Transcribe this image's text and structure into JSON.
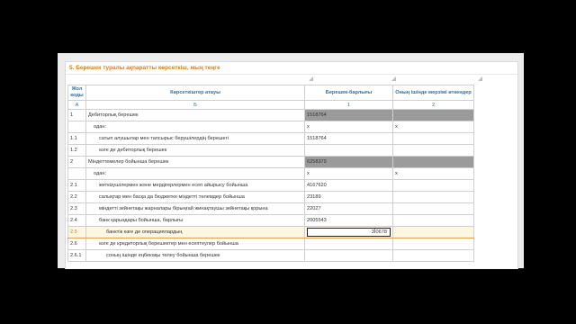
{
  "section_title": "5. Берешек туралы ақпаратты көрсеткіш, мың теңге",
  "headers": {
    "code": "Жол коды",
    "name": "Көрсеткіштер атауы",
    "debt": "Берешек-барлығы",
    "overdue": "Оның ішінде мерзімі өткендер"
  },
  "letters": {
    "code": "А",
    "name": "Б",
    "debt": "1",
    "overdue": "2"
  },
  "rows": [
    {
      "code": "1",
      "name": "Дебиторлық берешек",
      "debt": "1518764",
      "overdue": ""
    },
    {
      "code": "",
      "name": "одан:",
      "debt": "x",
      "overdue": "x"
    },
    {
      "code": "1.1",
      "name": "сатып алушылар мен тапсырыс берушілердің берешегі",
      "debt": "1518764",
      "overdue": ""
    },
    {
      "code": "1.2",
      "name": "өзге де дебиторлық берешек",
      "debt": "",
      "overdue": ""
    },
    {
      "code": "2",
      "name": "Міндеттемелер бойынша берешек",
      "debt": "6258379",
      "overdue": ""
    },
    {
      "code": "",
      "name": "одан:",
      "debt": "x",
      "overdue": "x"
    },
    {
      "code": "2.1",
      "name": "жеткізушілермен және мердігерлермен есеп айырысу бойынша",
      "debt": "4167620",
      "overdue": ""
    },
    {
      "code": "2.2",
      "name": "салықтар мен басқа да бюджетке міндетті төлемдер  бойынша",
      "debt": "23189",
      "overdue": ""
    },
    {
      "code": "2.3",
      "name": "міндетті зейнетақы жарналары бірыңғай жинақтаушы зейнетақы қорына",
      "debt": "22027",
      "overdue": ""
    },
    {
      "code": "2.4",
      "name": "банк қарыздары бойынша, барлығы",
      "debt": "2005543",
      "overdue": ""
    },
    {
      "code": "2.5",
      "name": "банктік өзге де операциялардың",
      "debt": "3ꟾ0678",
      "overdue": ""
    },
    {
      "code": "2.6",
      "name": "өзге де кредиторлық берешектер мен есептеулер  бойынша",
      "debt": "",
      "overdue": ""
    },
    {
      "code": "2.6.1",
      "name": "соның ішінде еңбекақы төлеу бойынша берешек",
      "debt": "",
      "overdue": ""
    }
  ],
  "colors": {
    "accent": "#e07b1a",
    "header_text": "#2f6f9f",
    "locked_cell": "#9b9b9b"
  }
}
